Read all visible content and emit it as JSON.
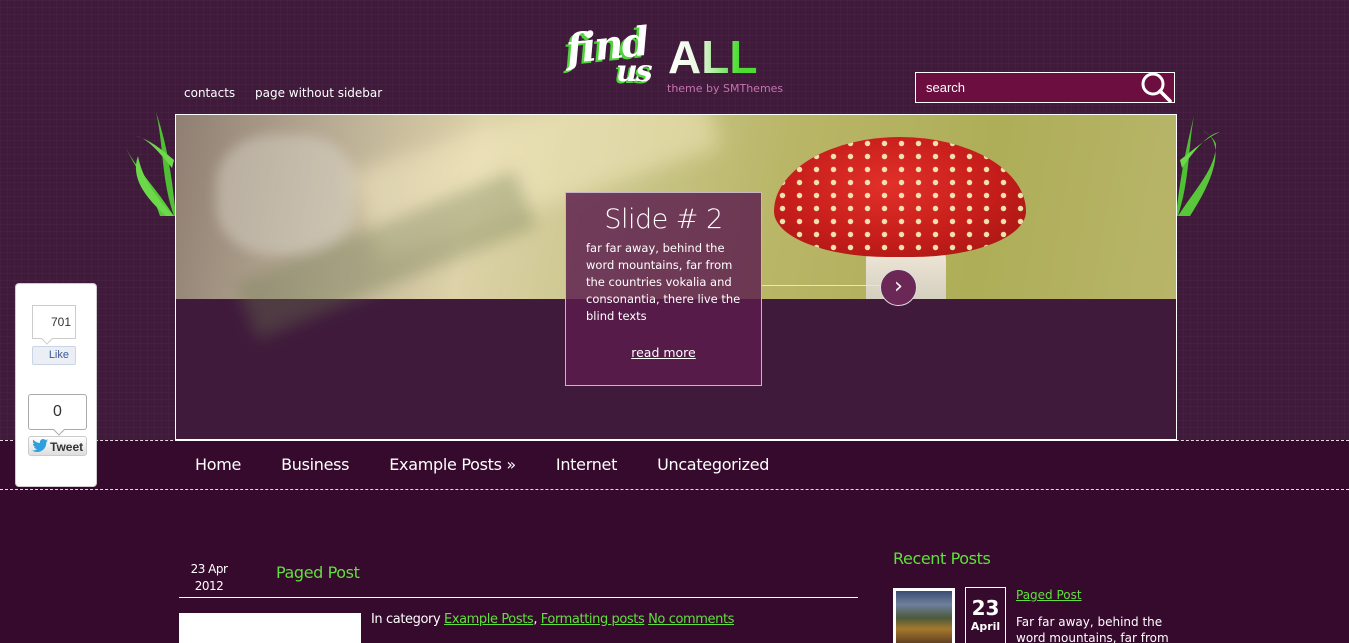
{
  "logo": {
    "word_find": "find",
    "word_us": "us",
    "word_all": "ALL",
    "tagline": "theme by SMThemes"
  },
  "top_links": [
    {
      "label": "contacts"
    },
    {
      "label": "page without sidebar"
    }
  ],
  "search": {
    "placeholder": "search",
    "value": ""
  },
  "slider": {
    "current_slide": {
      "title": "Slide # 2",
      "text": "far far away, behind the word mountains, far from the countries vokalia and consonantia, there live the blind texts",
      "link_label": "read more"
    },
    "next_label": "›"
  },
  "nav": {
    "items": [
      {
        "label": "Home"
      },
      {
        "label": "Business"
      },
      {
        "label": "Example Posts »"
      },
      {
        "label": "Internet"
      },
      {
        "label": "Uncategorized"
      }
    ]
  },
  "share": {
    "facebook": {
      "count": "701",
      "label": "Like"
    },
    "twitter": {
      "count": "0",
      "label": "Tweet"
    }
  },
  "post": {
    "date_day_month": "23 Apr",
    "date_year": "2012",
    "title": "Paged Post",
    "meta_prefix": "In category",
    "categories": [
      "Example Posts",
      "Formatting posts"
    ],
    "comments_label": "No comments"
  },
  "sidebar": {
    "widget_title": "Recent Posts",
    "recent_posts": [
      {
        "day": "23",
        "month": "April",
        "title": "Paged Post",
        "excerpt": "Far far away, behind the word mountains, far from"
      }
    ]
  },
  "colors": {
    "accent_green": "#5fe03c",
    "background": "#360a2c",
    "header_background": "#3f1a3b",
    "search_background": "#6c0e40"
  }
}
